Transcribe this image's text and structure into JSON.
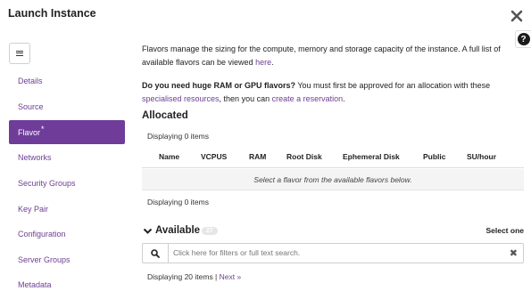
{
  "modal": {
    "title": "Launch Instance"
  },
  "sidebar": {
    "items": [
      {
        "label": "Details"
      },
      {
        "label": "Source"
      },
      {
        "label": "Flavor",
        "required_mark": "*"
      },
      {
        "label": "Networks"
      },
      {
        "label": "Security Groups"
      },
      {
        "label": "Key Pair"
      },
      {
        "label": "Configuration"
      },
      {
        "label": "Server Groups"
      },
      {
        "label": "Metadata"
      }
    ],
    "active": "Flavor"
  },
  "intro": {
    "text": "Flavors manage the sizing for the compute, memory and storage capacity of the instance. A full list of available flavors can be viewed ",
    "link": "here",
    "end": "."
  },
  "notice": {
    "question": "Do you need huge RAM or GPU flavors?",
    "text1": " You must first be approved for an allocation with these ",
    "link1": "specialised resources",
    "text2": ", then you can ",
    "link2": "create a reservation",
    "end": "."
  },
  "allocated": {
    "title": "Allocated",
    "count_top": "Displaying 0 items",
    "count_bottom": "Displaying 0 items",
    "columns": [
      "Name",
      "VCPUS",
      "RAM",
      "Root Disk",
      "Ephemeral Disk",
      "Public",
      "SU/hour"
    ],
    "empty_message": "Select a flavor from the available flavors below."
  },
  "available": {
    "title": "Available",
    "badge": "27",
    "select_label": "Select one",
    "search_placeholder": "Click here for filters or full text search.",
    "count": "Displaying 20 items | ",
    "next_link": "Next »"
  },
  "colors": {
    "accent": "#6f3d99",
    "link": "#6d3f93"
  }
}
